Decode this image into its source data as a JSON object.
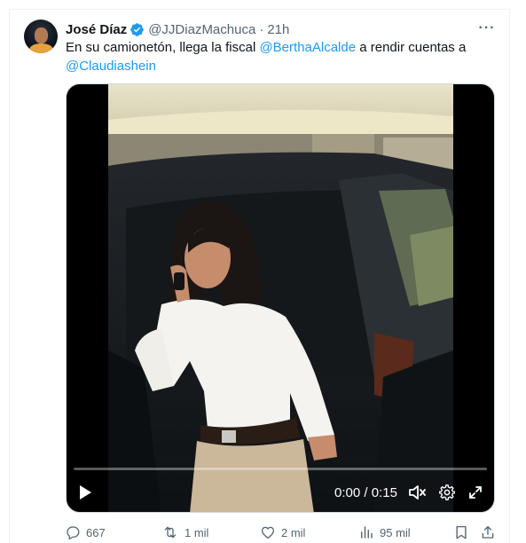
{
  "tweet": {
    "author": {
      "display_name": "José Díaz",
      "handle": "@JJDiazMachuca",
      "separator": "·",
      "time": "21h",
      "verified_color": "#1d9bf0"
    },
    "text": {
      "part1": "En su camionetón, llega la fiscal ",
      "mention1": "@BerthaAlcalde",
      "part2": " a rendir cuentas a",
      "mention2": "@Claudiashein"
    },
    "more_label": "···"
  },
  "video": {
    "current_time": "0:00",
    "time_separator": "/",
    "duration": "0:15",
    "progress_fraction": 0.0,
    "accent_color": "#1d9bf0",
    "icons": {
      "play": "play-icon",
      "mute": "muted-speaker-icon",
      "settings": "gear-icon",
      "fullscreen": "expand-icon"
    }
  },
  "actions": {
    "replies": "667",
    "reposts": "1 mil",
    "likes": "2 mil",
    "views": "95 mil"
  },
  "colors": {
    "text": "#0f1419",
    "secondary": "#536471",
    "link": "#1d9bf0"
  }
}
